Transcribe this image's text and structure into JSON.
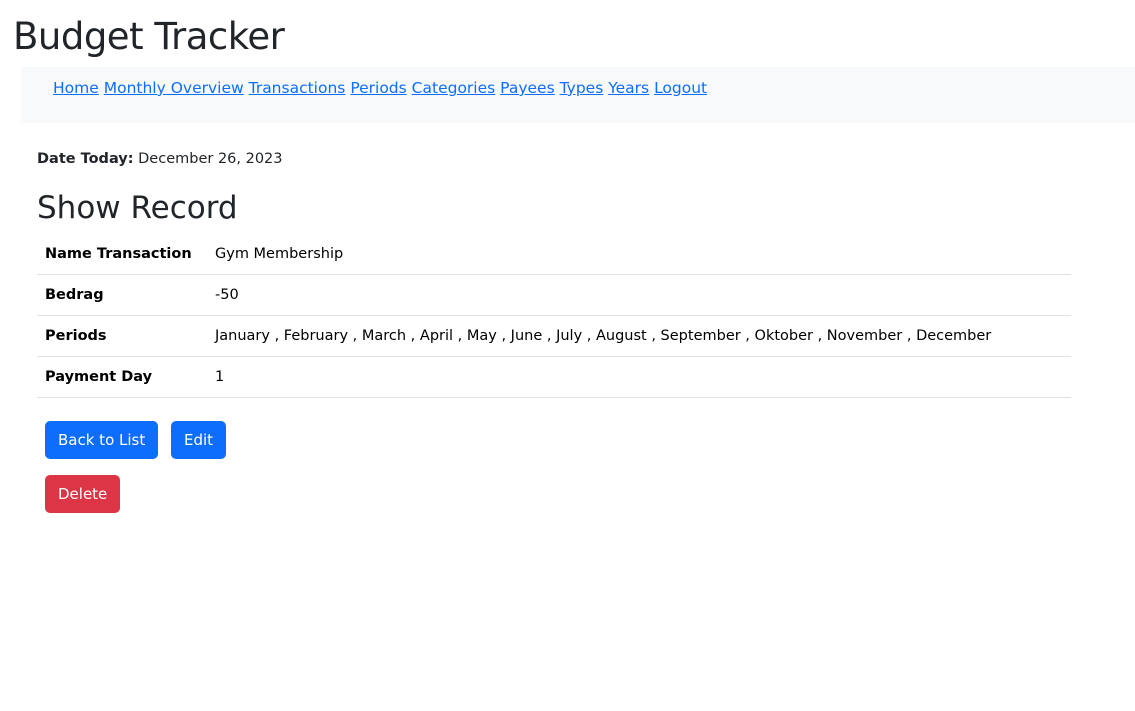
{
  "app_title": "Budget Tracker",
  "nav": [
    "Home",
    "Monthly Overview",
    "Transactions",
    "Periods",
    "Categories",
    "Payees",
    "Types",
    "Years",
    "Logout"
  ],
  "date_label": "Date Today:",
  "date_value": "December 26, 2023",
  "heading": "Show Record",
  "rows": [
    {
      "k": "Name Transaction",
      "v": "Gym Membership"
    },
    {
      "k": "Bedrag",
      "v": "-50"
    },
    {
      "k": "Periods",
      "v": "January , February , March , April , May , June , July , August , September , Oktober , November , December"
    },
    {
      "k": "Payment Day",
      "v": "1"
    }
  ],
  "buttons": {
    "back": "Back to List",
    "edit": "Edit",
    "delete": "Delete"
  }
}
